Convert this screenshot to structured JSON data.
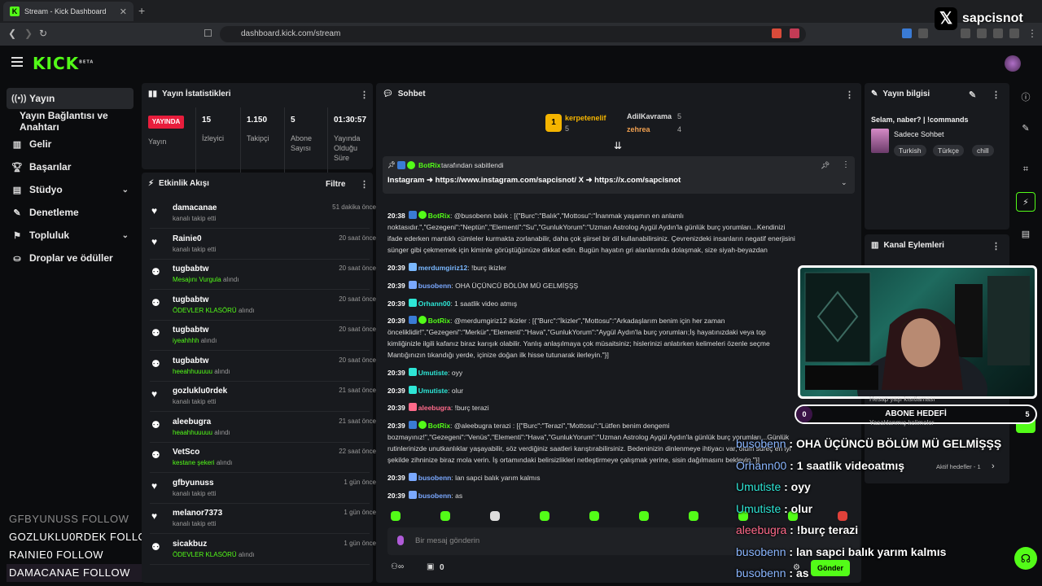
{
  "browser": {
    "tab_title": "Stream - Kick Dashboard",
    "url": "dashboard.kick.com/stream"
  },
  "x_badge": {
    "handle": "sapcisnot",
    "icon": "x-logo-icon"
  },
  "app": {
    "logo": "KICK",
    "logo_sup": "BETA"
  },
  "sidebar": {
    "items": [
      {
        "label": "Yayın",
        "icon": "broadcast-icon",
        "active": true
      },
      {
        "label": "Yayın Bağlantısı ve Anahtarı",
        "icon": ""
      },
      {
        "label": "Gelir",
        "icon": "chart-icon"
      },
      {
        "label": "Başarılar",
        "icon": "trophy-icon"
      },
      {
        "label": "Stüdyo",
        "icon": "studio-icon",
        "chevron": "⌄"
      },
      {
        "label": "Denetleme",
        "icon": "wrench-icon"
      },
      {
        "label": "Topluluk",
        "icon": "community-icon",
        "chevron": "⌄"
      },
      {
        "label": "Droplar ve ödüller",
        "icon": "drops-icon"
      }
    ]
  },
  "follow_overlay": [
    "GFBYUNUSS  FOLLOW",
    "GOZLUKLU0RDEK  FOLLOW",
    "RAINIE0  FOLLOW",
    "DAMACANAE  FOLLOW"
  ],
  "stats": {
    "title": "Yayın İstatistikleri",
    "live_label": "YAYINDA",
    "live_sub": "Yayın",
    "items": [
      {
        "value": "15",
        "label": "İzleyici"
      },
      {
        "value": "1.150",
        "label": "Takipçi"
      },
      {
        "value": "5",
        "label": "Abone Sayısı"
      },
      {
        "value": "01:30:57",
        "label": "Yayında Olduğu Süre"
      }
    ]
  },
  "activity": {
    "title": "Etkinlik Akışı",
    "filter": "Filtre",
    "items": [
      {
        "name": "damacanae",
        "sub": "kanalı takip etti",
        "green": "",
        "time": "51 dakika önce",
        "icon": "heart-icon"
      },
      {
        "name": "Rainie0",
        "sub": "kanalı takip etti",
        "green": "",
        "time": "20 saat önce",
        "icon": "heart-icon"
      },
      {
        "name": "tugbabtw",
        "sub": "alındı",
        "green": "Mesajını Vurgula",
        "time": "20 saat önce",
        "icon": "redeem-icon"
      },
      {
        "name": "tugbabtw",
        "sub": "alındı",
        "green": "ÖDEVLER KLASÖRÜ",
        "time": "20 saat önce",
        "icon": "redeem-icon"
      },
      {
        "name": "tugbabtw",
        "sub": "alındı",
        "green": "iyeahhhh",
        "time": "20 saat önce",
        "icon": "redeem-icon"
      },
      {
        "name": "tugbabtw",
        "sub": "alındı",
        "green": "heeahhuuuuu",
        "time": "20 saat önce",
        "icon": "redeem-icon"
      },
      {
        "name": "gozluklu0rdek",
        "sub": "kanalı takip etti",
        "green": "",
        "time": "21 saat önce",
        "icon": "heart-icon"
      },
      {
        "name": "aleebugra",
        "sub": "alındı",
        "green": "heaahhuuuuu",
        "time": "21 saat önce",
        "icon": "redeem-icon"
      },
      {
        "name": "VetSco",
        "sub": "alındı",
        "green": "kestane şekeri",
        "time": "22 saat önce",
        "icon": "redeem-icon"
      },
      {
        "name": "gfbyunuss",
        "sub": "kanalı takip etti",
        "green": "",
        "time": "1 gün önce",
        "icon": "heart-icon"
      },
      {
        "name": "melanor7373",
        "sub": "kanalı takip etti",
        "green": "",
        "time": "1 gün önce",
        "icon": "heart-icon"
      },
      {
        "name": "sicakbuz",
        "sub": "alındı",
        "green": "ÖDEVLER KLASÖRÜ",
        "time": "1 gün önce",
        "icon": "redeem-icon"
      }
    ]
  },
  "chat": {
    "title": "Sohbet",
    "top_gifters": [
      {
        "name": "kerpetenelif",
        "count": "5",
        "rank": "1"
      },
      {
        "name": "AdilKavrama",
        "count": "5"
      },
      {
        "name": "zehrea",
        "count": "4"
      }
    ],
    "pinned": {
      "by": "BotRix",
      "by_suffix": "tarafından sabitlendi",
      "text": "Instagram ➜ https://www.instagram.com/sapcisnot/ X ➜ https://x.com/sapcisnot"
    },
    "messages": [
      {
        "time": "20:38",
        "user": "BotRix",
        "color": "#53fc18",
        "badges": true,
        "text": "@busobenn balık : [{\"Burc\":\"Balık\",\"Mottosu\":\"İnanmak yaşamın en anlamlı noktasıdır.\",\"Gezegeni\":\"Neptün\",\"Elementi\":\"Su\",\"GunlukYorum\":\"Uzman Astrolog Aygül Aydın'la günlük burç yorumları...Kendinizi ifade ederken mantıklı cümleler kurmakta zorlanabilir, daha çok şiirsel bir dil kullanabilirsiniz. Çevrenizdeki insanların negatif enerjisini sünger gibi çekmemek için kiminle görüştüğünüze dikkat edin. Bugün hayatın gri alanlarında dolaşmak, size siyah-beyazdan"
      },
      {
        "time": "20:39",
        "user": "merdumgiriz12",
        "color": "#7ab8ff",
        "text": "!burç ikizler"
      },
      {
        "time": "20:39",
        "user": "busobenn",
        "color": "#7aa8ff",
        "text": "OHA ÜÇÜNCÜ BÖLÜM MÜ GELMİŞŞŞ"
      },
      {
        "time": "20:39",
        "user": "Orhann00",
        "color": "#2ee6d6",
        "text": "1 saatlik video atmış"
      },
      {
        "time": "20:39",
        "user": "BotRix",
        "color": "#53fc18",
        "badges": true,
        "text": "@merdumgiriz12 ikizler : [{\"Burc\":\"İkizler\",\"Mottosu\":\"Arkadaşlarım benim için her zaman önceliklidir!\",\"Gezegeni\":\"Merkür\",\"Elementi\":\"Hava\",\"GunlukYorum\":\"Aygül Aydın'la burç yorumları;İş hayatınızdaki veya top kimliğinizle ilgili kafanız biraz karışık olabilir. Yanlış anlaşılmaya çok müsaitsiniz; hislerinizi anlatırken kelimeleri özenle seçme Mantığınızın tıkandığı yerde, içinize doğan ilk hisse tutunarak ilerleyin.\"}]"
      },
      {
        "time": "20:39",
        "user": "Umutiste",
        "color": "#2ee6d6",
        "text": "oyy"
      },
      {
        "time": "20:39",
        "user": "Umutiste",
        "color": "#2ee6d6",
        "text": "olur"
      },
      {
        "time": "20:39",
        "user": "aleebugra",
        "color": "#ff6a8a",
        "text": "!burç terazi"
      },
      {
        "time": "20:39",
        "user": "BotRix",
        "color": "#53fc18",
        "badges": true,
        "text": "@aleebugra terazi : [{\"Burc\":\"Terazi\",\"Mottosu\":\"Lütfen benim dengemi bozmayınız!\",\"Gezegeni\":\"Venüs\",\"Elementi\":\"Hava\",\"GunlukYorum\":\"Uzman Astrolog Aygül Aydın'la günlük burç yorumları...Günlük rutinlerinizde unutkanlıklar yaşayabilir, söz verdiğiniz saatleri karıştırabilirsiniz. Bedeninizin dinlenmeye ihtiyacı var, ölüm süreç en iyi şekilde zihninize biraz mola verin. İş ortamındaki belirsizlikleri netleştirmeye çalışmak yerine, sisin dağılmasını bekleyin.\"}]"
      },
      {
        "time": "20:39",
        "user": "busobenn",
        "color": "#7aa8ff",
        "text": "lan sapci balık yarım kalmıs"
      },
      {
        "time": "20:39",
        "user": "busobenn",
        "color": "#7aa8ff",
        "text": "as"
      }
    ],
    "input_placeholder": "Bir mesaj gönderin",
    "points": "0",
    "gift_count": "0",
    "send_label": "Gönder"
  },
  "stream_info": {
    "title": "Yayın bilgisi",
    "stream_title": "Selam, naber? | !commands",
    "category": "Sadece Sohbet",
    "tags": [
      "Turkish",
      "Türkçe",
      "chill"
    ]
  },
  "channel_actions": {
    "title": "Kanal Eylemleri",
    "partial_items": [
      "Hesap yaşı kısıtlaması",
      "Yasaklanmış kelimeler",
      "Aktif hedefler - 1"
    ]
  },
  "overlay": {
    "goal_label": "ABONE HEDEFİ",
    "goal_current": "0",
    "goal_target": "5",
    "chat": [
      {
        "user": "busobenn",
        "text": ": OHA ÜÇÜNCÜ BÖLÜM MÜ GELMİŞŞŞ",
        "color": "#8ab6ff"
      },
      {
        "user": "Orhann00",
        "text": ": 1 saatlik videoatmış",
        "color": "#8ab6ff"
      },
      {
        "user": "Umutiste",
        "text": ": oyy",
        "color": "#2ee6d6"
      },
      {
        "user": "Umutiste",
        "text": ": olur",
        "color": "#2ee6d6"
      },
      {
        "user": "aleebugra",
        "text": ": !burç terazi",
        "color": "#ff6a8a"
      },
      {
        "user": "busobenn",
        "text": ": lan sapci balık yarım kalmıs",
        "color": "#8ab6ff"
      },
      {
        "user": "busobenn",
        "text": ": as",
        "color": "#8ab6ff"
      }
    ]
  },
  "colors": {
    "accent": "#53fc18",
    "live": "#e81d3c",
    "panel": "#181a1e"
  }
}
